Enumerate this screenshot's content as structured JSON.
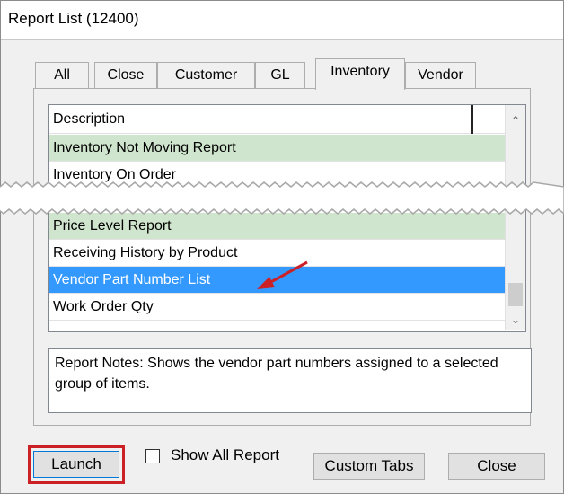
{
  "window": {
    "title": "Report List (12400)"
  },
  "tabs": [
    {
      "label": "All"
    },
    {
      "label": "Close"
    },
    {
      "label": "Customer"
    },
    {
      "label": "GL"
    },
    {
      "label": "Inventory"
    },
    {
      "label": "Vendor"
    }
  ],
  "active_tab": "Inventory",
  "list": {
    "header": "Description",
    "rows_top": [
      {
        "label": "Inventory Not Moving Report",
        "state": "green"
      },
      {
        "label": "Inventory On Order",
        "state": "normal"
      }
    ],
    "rows_bottom": [
      {
        "label": "Price Level Report",
        "state": "green"
      },
      {
        "label": "Receiving History by Product",
        "state": "normal"
      },
      {
        "label": "Vendor Part Number List",
        "state": "selected"
      },
      {
        "label": "Work Order Qty",
        "state": "normal"
      }
    ]
  },
  "notes": {
    "text": "Report Notes:  Shows the vendor part numbers assigned to a selected group of items."
  },
  "buttons": {
    "launch": "Launch",
    "show_all": "Show All Report",
    "custom_tabs": "Custom Tabs",
    "close": "Close"
  },
  "colors": {
    "selection": "#3399ff",
    "green_row": "#cfe5cd",
    "highlight": "#cc2027"
  }
}
